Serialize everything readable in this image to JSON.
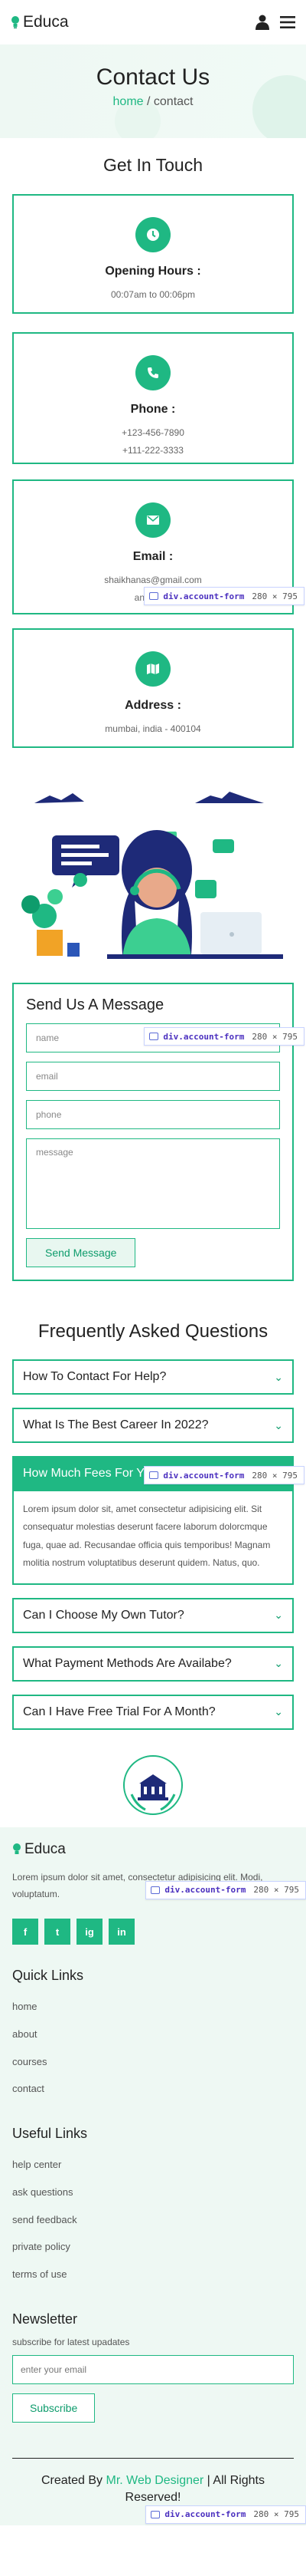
{
  "header": {
    "brand": "Educa"
  },
  "hero": {
    "title": "Contact Us",
    "crumb_home": "home",
    "crumb_sep": " / ",
    "crumb_current": "contact"
  },
  "get_in_touch": {
    "title": "Get In Touch",
    "cards": [
      {
        "label": "Opening Hours :",
        "lines": [
          "00:07am to 00:06pm"
        ]
      },
      {
        "label": "Phone :",
        "lines": [
          "+123-456-7890",
          "+111-222-3333"
        ]
      },
      {
        "label": "Email :",
        "lines": [
          "shaikhanas@gmail.com",
          "anasbhai"
        ]
      },
      {
        "label": "Address :",
        "lines": [
          "mumbai, india - 400104"
        ]
      }
    ]
  },
  "inspector_badge": {
    "name": "div.account-form",
    "size": "280 × 795"
  },
  "form": {
    "title": "Send Us A Message",
    "name_ph": "name",
    "email_ph": "email",
    "phone_ph": "phone",
    "message_ph": "message",
    "submit": "Send Message"
  },
  "faq": {
    "title": "Frequently Asked Questions",
    "items": [
      "How To Contact For Help?",
      "What Is The Best Career In 2022?",
      "How Much Fees For Y",
      "Can I Choose My Own Tutor?",
      "What Payment Methods Are Availabe?",
      "Can I Have Free Trial For A Month?"
    ],
    "open_body": "Lorem ipsum dolor sit, amet consectetur adipisicing elit. Sit consequatur molestias deserunt facere laborum dolorcmque fuga, quae ad. Recusandae officia quis temporibus! Magnam molitia nostrum voluptatibus deserunt quidem. Natus, quo."
  },
  "college_logo": {
    "text": "COLLEGE LOGO"
  },
  "footer": {
    "brand": "Educa",
    "desc": "Lorem ipsum dolor sit amet, consectetur adipisicing elit. Modi, voluptatum.",
    "socials": [
      "f",
      "t",
      "ig",
      "in"
    ],
    "quick_links_title": "Quick Links",
    "quick_links": [
      "home",
      "about",
      "courses",
      "contact"
    ],
    "useful_links_title": "Useful Links",
    "useful_links": [
      "help center",
      "ask questions",
      "send feedback",
      "private policy",
      "terms of use"
    ],
    "newsletter_title": "Newsletter",
    "newsletter_sub": "subscribe for latest upadates",
    "newsletter_ph": "enter your email",
    "subscribe": "Subscribe",
    "credit_pre": "Created By ",
    "credit_name": "Mr. Web Designer",
    "credit_post": " | All Rights Reserved!"
  },
  "colors": {
    "accent": "#1fb883",
    "accent_dark": "#0e9c6c",
    "hero_bg": "#eef8f3",
    "inspector_name": "#4a2fbf"
  },
  "icons": [
    "bulb-icon",
    "user-icon",
    "menu-icon",
    "clock-icon",
    "phone-icon",
    "envelope-icon",
    "map-icon",
    "chevron-down-icon",
    "facebook-icon",
    "twitter-icon",
    "instagram-icon",
    "linkedin-icon",
    "college-logo-icon"
  ]
}
